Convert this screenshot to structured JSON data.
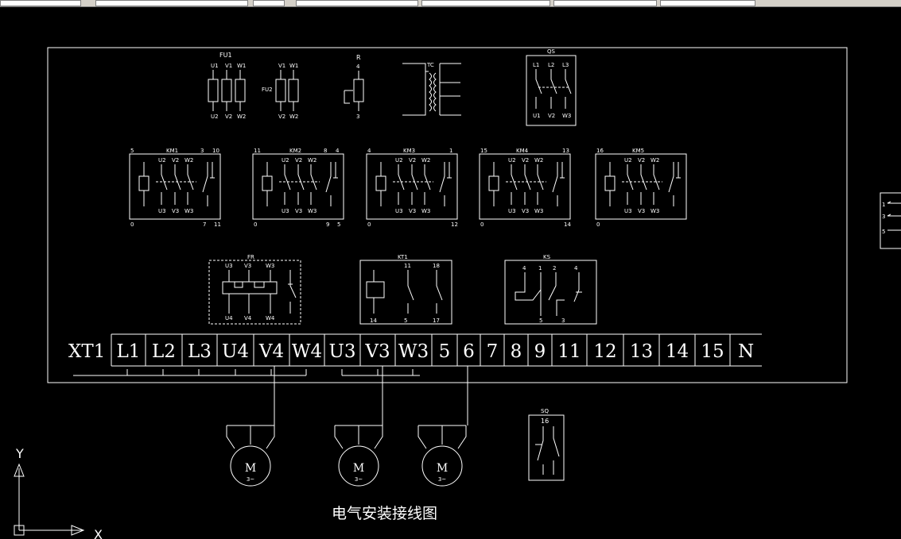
{
  "title": "电气安装接线图",
  "fuses": {
    "fu1": {
      "label": "FU1",
      "top": [
        "U1",
        "V1",
        "W1"
      ],
      "bottom": [
        "U2",
        "V2",
        "W2"
      ]
    },
    "fu2": {
      "label": "FU2",
      "top": [
        "V1",
        "W1"
      ],
      "bottom": [
        "V2",
        "W2"
      ]
    }
  },
  "resistor": {
    "label": "R",
    "top": "4",
    "bottom": "3"
  },
  "transformer": {
    "label": "TC"
  },
  "switch_qs": {
    "label": "QS",
    "top": [
      "L1",
      "L2",
      "L3"
    ],
    "bottom": [
      "U1",
      "V2",
      "W3"
    ]
  },
  "contactors": [
    {
      "label": "KM1",
      "tl": "5",
      "tr1": "3",
      "tr2": "10",
      "bl": "0",
      "br1": "7",
      "br2": "11",
      "top": [
        "U2",
        "V2",
        "W2"
      ],
      "bottom": [
        "U3",
        "V3",
        "W3"
      ]
    },
    {
      "label": "KM2",
      "tl": "11",
      "tr1": "8",
      "tr2": "4",
      "bl": "0",
      "br1": "9",
      "br2": "5",
      "top": [
        "U2",
        "V2",
        "W2"
      ],
      "bottom": [
        "U3",
        "V3",
        "W3"
      ]
    },
    {
      "label": "KM3",
      "tl": "4",
      "tr1": "",
      "tr2": "1",
      "bl": "0",
      "br1": "",
      "br2": "12",
      "top": [
        "U2",
        "V2",
        "W2"
      ],
      "bottom": [
        "U3",
        "V3",
        "W3"
      ]
    },
    {
      "label": "KM4",
      "tl": "15",
      "tr1": "",
      "tr2": "13",
      "bl": "0",
      "br1": "",
      "br2": "14",
      "top": [
        "U2",
        "V2",
        "W2"
      ],
      "bottom": [
        "U3",
        "V3",
        "W3"
      ]
    },
    {
      "label": "KM5",
      "tl": "16",
      "tr1": "",
      "tr2": "",
      "bl": "0",
      "br1": "",
      "br2": "",
      "top": [
        "U2",
        "V2",
        "W2"
      ],
      "bottom": [
        "U3",
        "V3",
        "W3"
      ]
    }
  ],
  "relay_fr": {
    "label": "FR",
    "top": [
      "U3",
      "V3",
      "W3"
    ],
    "bottom": [
      "U4",
      "V4",
      "W4"
    ]
  },
  "relay_kt": {
    "label": "KT1",
    "top": [
      "11",
      "18"
    ],
    "bottom": [
      "14",
      "5",
      "17"
    ]
  },
  "relay_ks": {
    "label": "KS",
    "top": [
      "4",
      "1",
      "2",
      "4"
    ],
    "bottom": [
      "5",
      "3"
    ]
  },
  "limit_sq": {
    "label": "SQ",
    "top": "16"
  },
  "terminal_strip": {
    "label": "XT1",
    "terminals": [
      "L1",
      "L2",
      "L3",
      "U4",
      "V4",
      "W4",
      "U3",
      "V3",
      "W3",
      "5",
      "6",
      "7",
      "8",
      "9",
      "11",
      "12",
      "13",
      "14",
      "15",
      "N"
    ]
  },
  "motors": [
    {
      "label": "M",
      "sub": "3~"
    },
    {
      "label": "M",
      "sub": "3~"
    },
    {
      "label": "M",
      "sub": "3~"
    }
  ],
  "side_block": {
    "labels": [
      "1",
      "3",
      "5"
    ]
  },
  "ucs": {
    "x": "X",
    "y": "Y"
  }
}
